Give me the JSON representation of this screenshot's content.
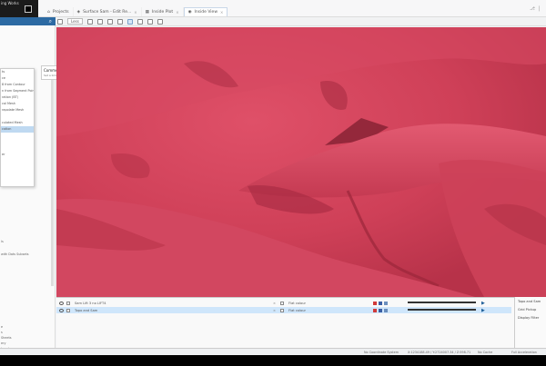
{
  "window": {
    "title": "ing Works"
  },
  "tabs": [
    {
      "label": "Projects",
      "icon": "home-icon"
    },
    {
      "label": "Surface Sam - Edit Re...",
      "icon": "surface-icon"
    },
    {
      "label": "Inside Plot",
      "icon": "plot-icon"
    },
    {
      "label": "Inside View",
      "icon": "view-icon"
    }
  ],
  "toolbar": {
    "view_select": "Less"
  },
  "sidebar": {
    "menu": [
      {
        "label": "ts"
      },
      {
        "label": "ce"
      },
      {
        "label": "8 from Contour"
      },
      {
        "label": "n from Segment Point"
      },
      {
        "label": "ration (BT)"
      },
      {
        "label": "cal Mesh"
      },
      {
        "label": "rapolate Mesh"
      },
      {
        "label": ""
      },
      {
        "label": "culated Mesh"
      },
      {
        "label": "cation"
      },
      {
        "label": ""
      },
      {
        "label": ""
      },
      {
        "label": ""
      },
      {
        "label": "er"
      }
    ],
    "tooltip_title": "Comments",
    "tooltip_sub": "Set a limit for dat",
    "misc": [
      "ls",
      "with Dats Subsets",
      "e",
      "s",
      "Sheets",
      "ery",
      "(mm)"
    ]
  },
  "panel": {
    "rows": [
      {
        "name": "Sam Lift 3 no LIFT4",
        "kind": "Flat colour",
        "selected": false
      },
      {
        "name": "Topo and Sam",
        "kind": "Flat colour",
        "selected": true
      }
    ]
  },
  "right_panel": {
    "title": "Topo and Sam",
    "f1": "Grid Pickup",
    "f2": "Display Filter"
  },
  "status": {
    "a": "No Coordinate System",
    "b": "X:1234188.49 / Y:2724007.34 / Z:598.71",
    "c": "No Cache",
    "d": "Full Acceleration"
  },
  "colors": {
    "surface": "#d4455d",
    "accent": "#2c6aa3"
  }
}
